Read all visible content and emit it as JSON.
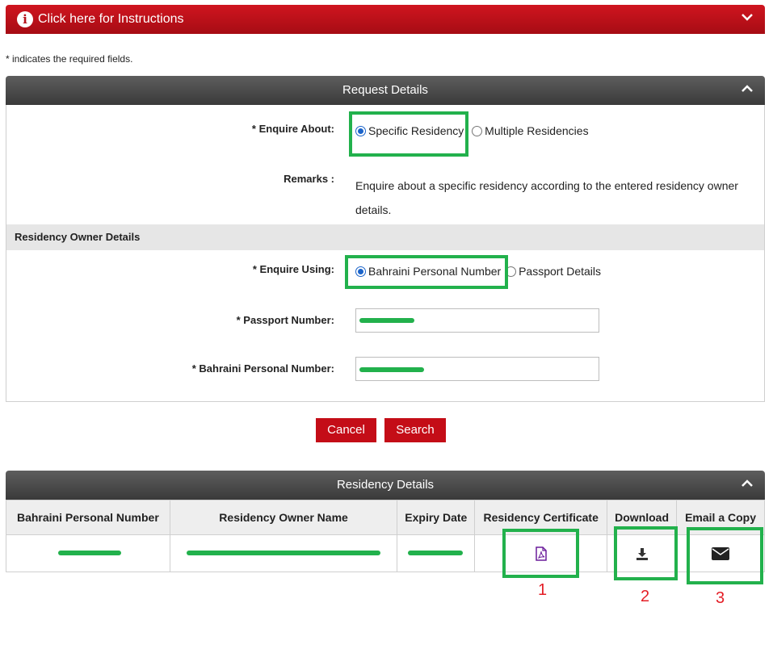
{
  "instructions": {
    "label": "Click here for Instructions"
  },
  "required_note": "* indicates the required fields.",
  "request": {
    "title": "Request Details",
    "enquire_about_label": "* Enquire About:",
    "option_specific": "Specific Residency",
    "option_multiple": "Multiple Residencies",
    "remarks_label": "Remarks :",
    "remarks_line1": "Enquire about a specific residency according to the entered residency owner",
    "remarks_line2": "details."
  },
  "owner": {
    "section_title": "Residency Owner Details",
    "enquire_using_label": "* Enquire Using:",
    "option_cpr": "Bahraini Personal Number",
    "option_passport": "Passport Details",
    "passport_label": "* Passport Number:",
    "cpr_label": "* Bahraini Personal Number:"
  },
  "buttons": {
    "cancel": "Cancel",
    "search": "Search"
  },
  "residency": {
    "title": "Residency Details",
    "headers": [
      "Bahraini Personal Number",
      "Residency Owner Name",
      "Expiry Date",
      "Residency Certificate",
      "Download",
      "Email a Copy"
    ]
  },
  "annotations": [
    "1",
    "2",
    "3"
  ],
  "colors": {
    "accent_red": "#c40d17",
    "highlight_green": "#22b14c",
    "header_dark": "#4a4a4a"
  }
}
